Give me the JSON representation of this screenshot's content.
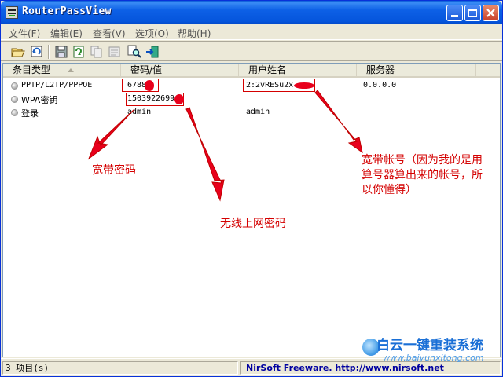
{
  "window": {
    "title": "RouterPassView"
  },
  "menu": [
    {
      "label": "文件(F)"
    },
    {
      "label": "编辑(E)"
    },
    {
      "label": "查看(V)"
    },
    {
      "label": "选项(O)"
    },
    {
      "label": "帮助(H)"
    }
  ],
  "toolbar": {
    "icons": [
      "open-folder-icon",
      "refresh-icon",
      "save-icon",
      "copy-html-icon",
      "copy-icon",
      "properties-icon",
      "find-icon",
      "exit-icon"
    ]
  },
  "columns": [
    {
      "label": "条目类型"
    },
    {
      "label": "密码/值"
    },
    {
      "label": "用户姓名"
    },
    {
      "label": "服务器"
    }
  ],
  "rows": [
    {
      "type": "PPTP/L2TP/PPPOE",
      "value": "6788",
      "user": "2:2vRESu2x",
      "server": "0.0.0.0"
    },
    {
      "type": "WPA密钥",
      "value": "1503922699",
      "user": "",
      "server": ""
    },
    {
      "type": "登录",
      "value": "admin",
      "user": "admin",
      "server": ""
    }
  ],
  "annotations": {
    "broadband_password": "宽带密码",
    "wireless_password": "无线上网密码",
    "broadband_account_lines": [
      "宽带帐号（因为我的是用",
      "算号器算出来的帐号，所",
      "以你懂得）"
    ]
  },
  "status": {
    "items": "3 项目(s)",
    "credit": "NirSoft Freeware.  http://www.nirsoft.net"
  },
  "watermark": {
    "name": "白云一键重装系统",
    "url": "www.baiyunxitong.com"
  },
  "colors": {
    "annotation": "#d40000",
    "titlebar": "#0d60e6"
  }
}
